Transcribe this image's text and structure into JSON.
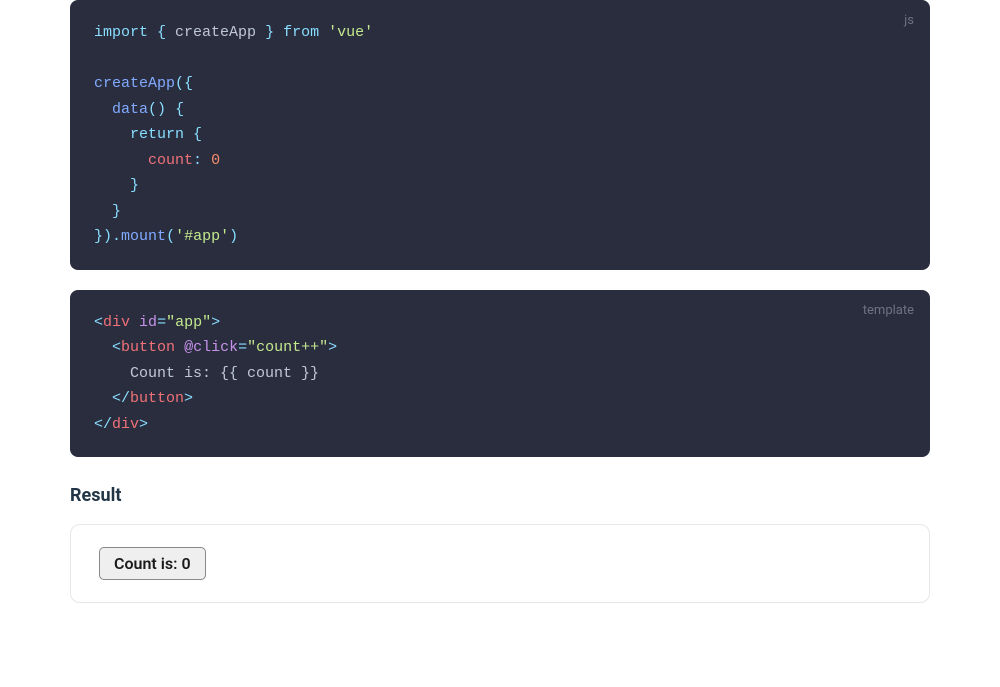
{
  "code_blocks": [
    {
      "lang": "js",
      "lines": [
        [
          {
            "cls": "tok-kw",
            "t": "import"
          },
          {
            "cls": "tok-plain",
            "t": " "
          },
          {
            "cls": "tok-punc",
            "t": "{"
          },
          {
            "cls": "tok-plain",
            "t": " createApp "
          },
          {
            "cls": "tok-punc",
            "t": "}"
          },
          {
            "cls": "tok-plain",
            "t": " "
          },
          {
            "cls": "tok-kw",
            "t": "from"
          },
          {
            "cls": "tok-plain",
            "t": " "
          },
          {
            "cls": "tok-str",
            "t": "'vue'"
          }
        ],
        [
          {
            "cls": "tok-plain",
            "t": ""
          }
        ],
        [
          {
            "cls": "tok-fn",
            "t": "createApp"
          },
          {
            "cls": "tok-punc",
            "t": "("
          },
          {
            "cls": "tok-punc",
            "t": "{"
          }
        ],
        [
          {
            "cls": "tok-plain",
            "t": "  "
          },
          {
            "cls": "tok-fn",
            "t": "data"
          },
          {
            "cls": "tok-punc",
            "t": "()"
          },
          {
            "cls": "tok-plain",
            "t": " "
          },
          {
            "cls": "tok-punc",
            "t": "{"
          }
        ],
        [
          {
            "cls": "tok-plain",
            "t": "    "
          },
          {
            "cls": "tok-kw",
            "t": "return"
          },
          {
            "cls": "tok-plain",
            "t": " "
          },
          {
            "cls": "tok-punc",
            "t": "{"
          }
        ],
        [
          {
            "cls": "tok-plain",
            "t": "      "
          },
          {
            "cls": "tok-prop",
            "t": "count"
          },
          {
            "cls": "tok-punc",
            "t": ":"
          },
          {
            "cls": "tok-plain",
            "t": " "
          },
          {
            "cls": "tok-num",
            "t": "0"
          }
        ],
        [
          {
            "cls": "tok-plain",
            "t": "    "
          },
          {
            "cls": "tok-punc",
            "t": "}"
          }
        ],
        [
          {
            "cls": "tok-plain",
            "t": "  "
          },
          {
            "cls": "tok-punc",
            "t": "}"
          }
        ],
        [
          {
            "cls": "tok-punc",
            "t": "}"
          },
          {
            "cls": "tok-punc",
            "t": ")"
          },
          {
            "cls": "tok-punc",
            "t": "."
          },
          {
            "cls": "tok-fn",
            "t": "mount"
          },
          {
            "cls": "tok-punc",
            "t": "("
          },
          {
            "cls": "tok-str",
            "t": "'#app'"
          },
          {
            "cls": "tok-punc",
            "t": ")"
          }
        ]
      ]
    },
    {
      "lang": "template",
      "lines": [
        [
          {
            "cls": "tok-lt",
            "t": "<"
          },
          {
            "cls": "tok-tag",
            "t": "div"
          },
          {
            "cls": "tok-plain",
            "t": " "
          },
          {
            "cls": "tok-attr",
            "t": "id"
          },
          {
            "cls": "tok-punc",
            "t": "="
          },
          {
            "cls": "tok-str",
            "t": "\"app\""
          },
          {
            "cls": "tok-lt",
            "t": ">"
          }
        ],
        [
          {
            "cls": "tok-plain",
            "t": "  "
          },
          {
            "cls": "tok-lt",
            "t": "<"
          },
          {
            "cls": "tok-tag",
            "t": "button"
          },
          {
            "cls": "tok-plain",
            "t": " "
          },
          {
            "cls": "tok-attr",
            "t": "@click"
          },
          {
            "cls": "tok-punc",
            "t": "="
          },
          {
            "cls": "tok-str",
            "t": "\"count++\""
          },
          {
            "cls": "tok-lt",
            "t": ">"
          }
        ],
        [
          {
            "cls": "tok-plain",
            "t": "    "
          },
          {
            "cls": "tok-text",
            "t": "Count is: {{ count }}"
          }
        ],
        [
          {
            "cls": "tok-plain",
            "t": "  "
          },
          {
            "cls": "tok-lt",
            "t": "</"
          },
          {
            "cls": "tok-tag",
            "t": "button"
          },
          {
            "cls": "tok-lt",
            "t": ">"
          }
        ],
        [
          {
            "cls": "tok-lt",
            "t": "</"
          },
          {
            "cls": "tok-tag",
            "t": "div"
          },
          {
            "cls": "tok-lt",
            "t": ">"
          }
        ]
      ]
    }
  ],
  "result": {
    "heading": "Result",
    "button_label": "Count is: 0"
  }
}
